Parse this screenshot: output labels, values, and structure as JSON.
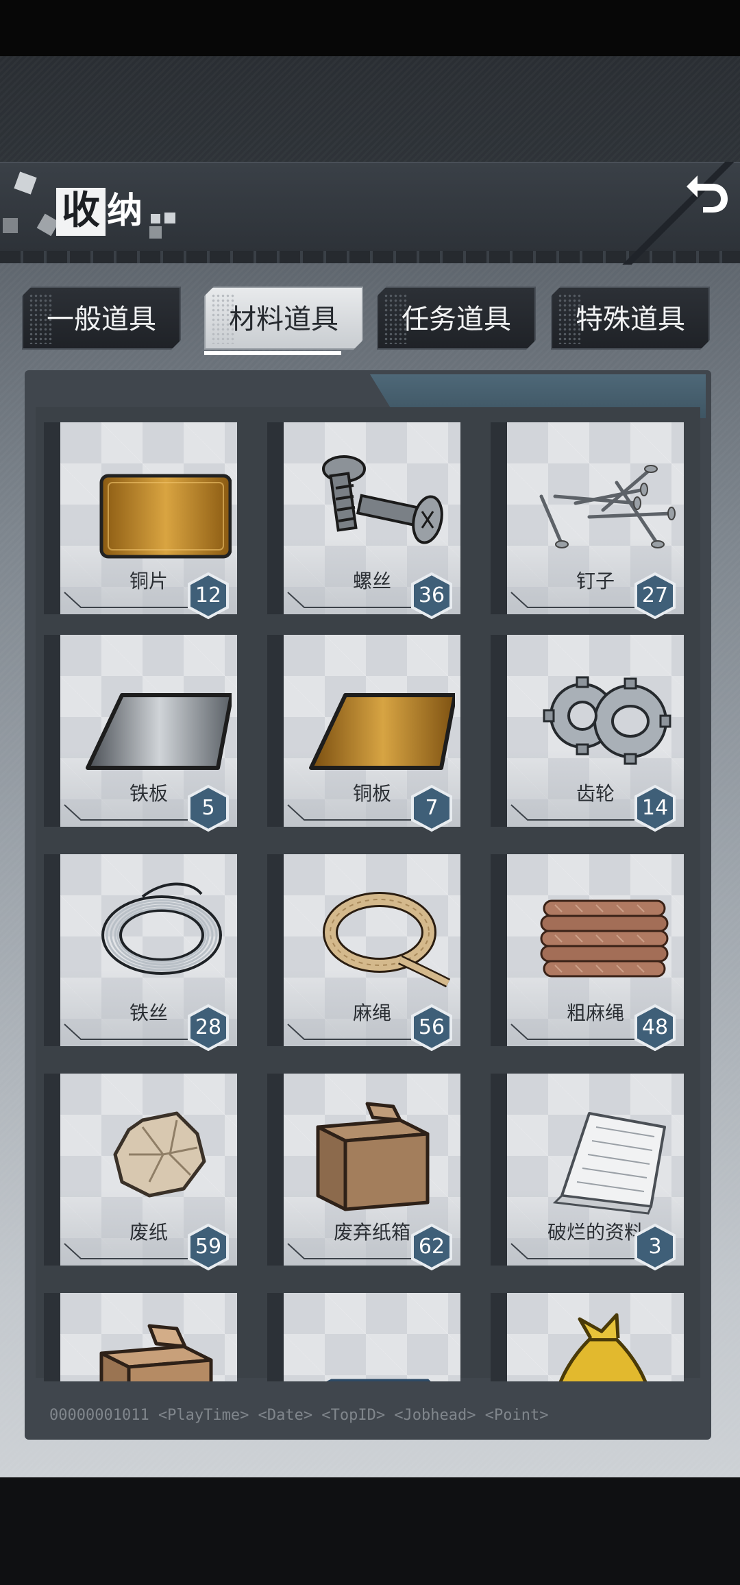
{
  "header": {
    "title_highlight": "收",
    "title_rest": "纳",
    "back_icon": "back-arrow-icon"
  },
  "tabs": [
    {
      "label": "一般道具",
      "active": false
    },
    {
      "label": "材料道具",
      "active": true
    },
    {
      "label": "任务道具",
      "active": false
    },
    {
      "label": "特殊道具",
      "active": false
    }
  ],
  "items": [
    {
      "name": "铜片",
      "count": "12",
      "icon": "copper-sheet-icon"
    },
    {
      "name": "螺丝",
      "count": "36",
      "icon": "screws-icon"
    },
    {
      "name": "钉子",
      "count": "27",
      "icon": "nails-icon"
    },
    {
      "name": "铁板",
      "count": "5",
      "icon": "iron-plate-icon"
    },
    {
      "name": "铜板",
      "count": "7",
      "icon": "copper-plate-icon"
    },
    {
      "name": "齿轮",
      "count": "14",
      "icon": "gears-icon"
    },
    {
      "name": "铁丝",
      "count": "28",
      "icon": "iron-wire-icon"
    },
    {
      "name": "麻绳",
      "count": "56",
      "icon": "hemp-rope-icon"
    },
    {
      "name": "粗麻绳",
      "count": "48",
      "icon": "thick-hemp-rope-icon"
    },
    {
      "name": "废纸",
      "count": "59",
      "icon": "waste-paper-icon"
    },
    {
      "name": "废弃纸箱",
      "count": "62",
      "icon": "cardboard-box-icon"
    },
    {
      "name": "破烂的资料",
      "count": "3",
      "icon": "tattered-documents-icon"
    },
    {
      "name": "",
      "count": "",
      "icon": "cardboard-box-icon"
    },
    {
      "name": "",
      "count": "",
      "icon": "plastic-bottle-icon"
    },
    {
      "name": "",
      "count": "",
      "icon": "yellow-trash-bag-icon"
    }
  ],
  "footer_text": "00000001011    <PlayTime>  <Date>  <TopID>  <Jobhead>  <Point>",
  "colors": {
    "badge_fill": "#3f5f78",
    "badge_border": "#e8ecf0",
    "copper": "#b8862e",
    "iron": "#8a9096"
  }
}
